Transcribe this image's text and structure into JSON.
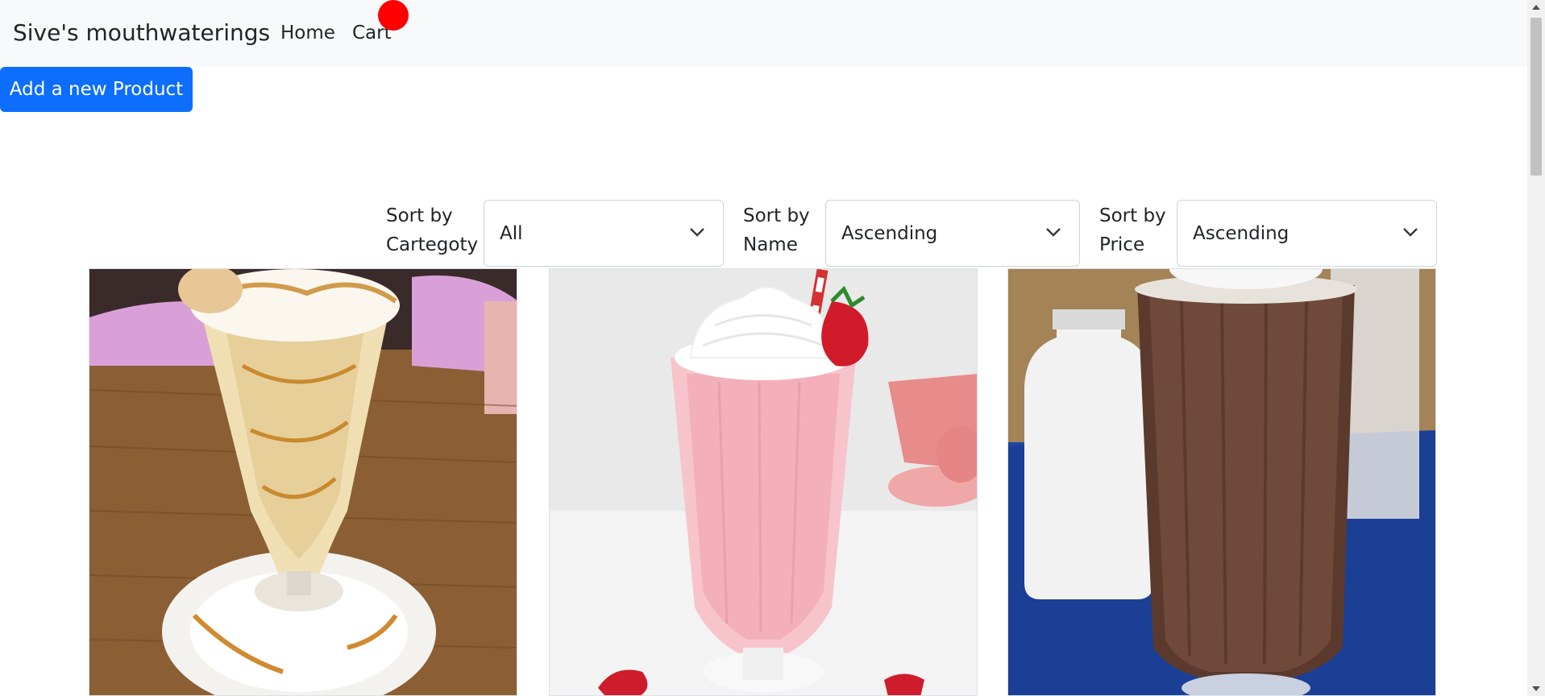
{
  "navbar": {
    "brand": "Sive's mouthwaterings",
    "links": [
      "Home",
      "Cart"
    ]
  },
  "actions": {
    "add_product_label": "Add a new Product"
  },
  "filters": {
    "category_label": [
      "Sort by",
      "Cartegoty"
    ],
    "category_value": "All",
    "name_label": [
      "Sort by",
      "Name"
    ],
    "name_value": "Ascending",
    "price_label": [
      "Sort by",
      "Price"
    ],
    "price_value": "Ascending"
  },
  "products": [
    {
      "image": "caramel-milkshake-image"
    },
    {
      "image": "strawberry-milkshake-image"
    },
    {
      "image": "chocolate-milkshake-image"
    }
  ],
  "colors": {
    "primary": "#0d6efd",
    "navbar_bg": "#f8f9fa",
    "cart_badge": "#ff0000"
  }
}
